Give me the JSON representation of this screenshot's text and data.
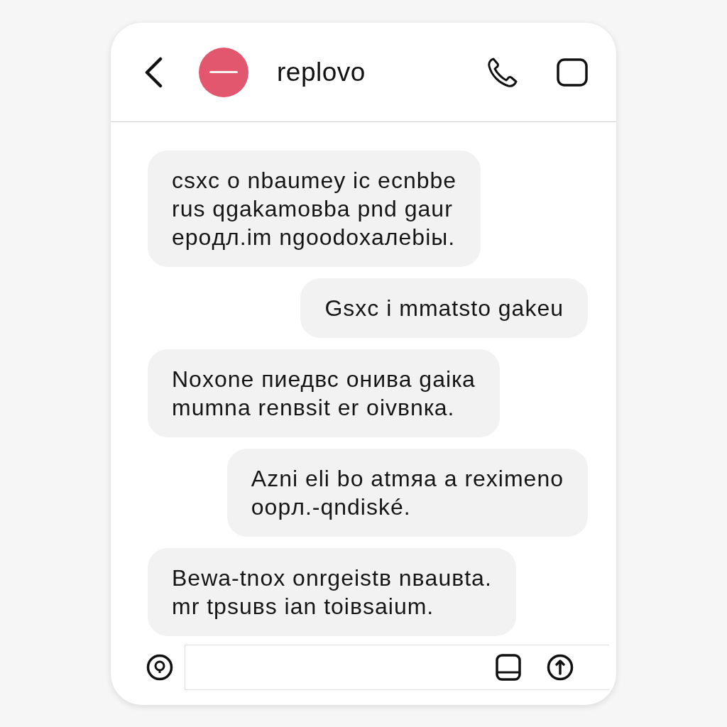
{
  "header": {
    "contact_name": "replovo"
  },
  "messages": [
    {
      "kind": "incoming",
      "text": "csxc o nbaumey ic ecnbbe\nrus qgakamoвba pnd gaur\nepoдл.im ngoodoxaлebiы."
    },
    {
      "kind": "outgoing",
      "text": "Gsxc i mmatsto gakeu"
    },
    {
      "kind": "incoming",
      "text": "Noxone пиедвс онива gaiкa\nmumna renвsit er oivвnкa."
    },
    {
      "kind": "outgoing",
      "text": "Azni eli bo atmяa a reximeno\noopл.-qndiské."
    },
    {
      "kind": "incoming",
      "text": "Bewa-tnox onrgeistв nвauвta.\nmr tpsuвs ian toiвsaium."
    }
  ]
}
